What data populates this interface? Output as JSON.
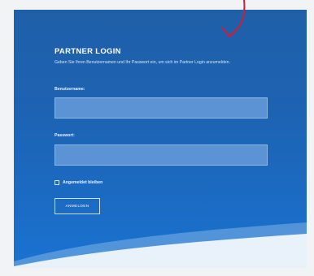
{
  "login": {
    "title": "PARTNER LOGIN",
    "intro": "Geben Sie Ihren Benutzernamen und Ihr Passwort ein, um sich im Partner Login anzumelden.",
    "username_label": "Benutzername:",
    "username_value": "",
    "password_label": "Passwort:",
    "password_value": "",
    "remember_label": "Angemeldet bleiben",
    "remember_checked": false,
    "submit_label": "ANMELDEN"
  },
  "colors": {
    "panel_blue": "#1d63b3",
    "field_blue": "#5b93d4",
    "arrow": "#c8203a"
  },
  "icons": {
    "annotation": "curved-arrow-down-icon",
    "remember": "checkbox-icon"
  }
}
